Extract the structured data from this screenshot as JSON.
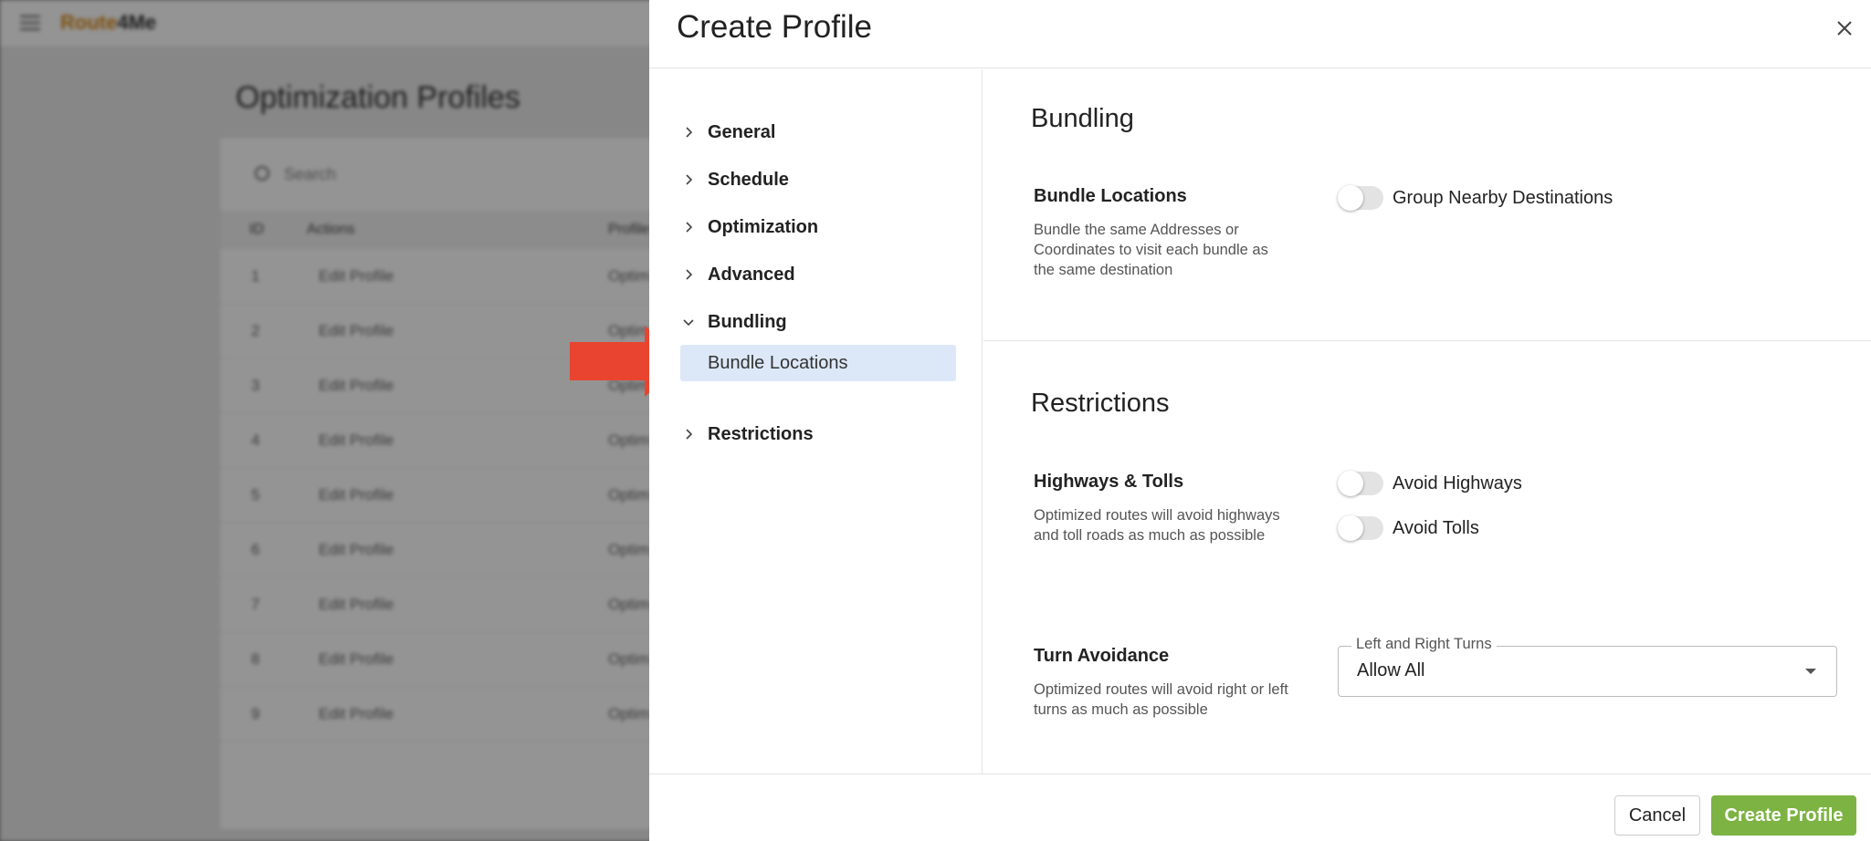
{
  "background": {
    "logo_prefix": "Route",
    "logo_suffix": "4Me",
    "page_title": "Optimization Profiles",
    "search_placeholder": "Search",
    "columns": [
      "ID",
      "Actions",
      "Profile"
    ],
    "rows": [
      {
        "id": "1",
        "action": "Edit Profile",
        "profile": "Optim"
      },
      {
        "id": "2",
        "action": "Edit Profile",
        "profile": "Optim"
      },
      {
        "id": "3",
        "action": "Edit Profile",
        "profile": "Optim"
      },
      {
        "id": "4",
        "action": "Edit Profile",
        "profile": "Optim"
      },
      {
        "id": "5",
        "action": "Edit Profile",
        "profile": "Optim"
      },
      {
        "id": "6",
        "action": "Edit Profile",
        "profile": "Optim"
      },
      {
        "id": "7",
        "action": "Edit Profile",
        "profile": "Optim"
      },
      {
        "id": "8",
        "action": "Edit Profile",
        "profile": "Optim"
      },
      {
        "id": "9",
        "action": "Edit Profile",
        "profile": "Optim"
      }
    ]
  },
  "drawer": {
    "title": "Create Profile",
    "close_icon": "close-icon"
  },
  "nav": {
    "items": [
      {
        "label": "General",
        "expanded": false
      },
      {
        "label": "Schedule",
        "expanded": false
      },
      {
        "label": "Optimization",
        "expanded": false
      },
      {
        "label": "Advanced",
        "expanded": false
      },
      {
        "label": "Bundling",
        "expanded": true
      },
      {
        "label": "Restrictions",
        "expanded": false
      }
    ],
    "active_sub": "Bundle Locations"
  },
  "bundling": {
    "title": "Bundling",
    "bundle_locations": {
      "title": "Bundle Locations",
      "desc": "Bundle the same Addresses or Coordinates to visit each bundle as the same destination",
      "toggle_label": "Group Nearby Destinations",
      "toggle_on": false
    }
  },
  "restrictions": {
    "title": "Restrictions",
    "highways_tolls": {
      "title": "Highways & Tolls",
      "desc": "Optimized routes will avoid highways and toll roads as much as possible",
      "avoid_highways_label": "Avoid Highways",
      "avoid_highways_on": false,
      "avoid_tolls_label": "Avoid Tolls",
      "avoid_tolls_on": false
    },
    "turn_avoidance": {
      "title": "Turn Avoidance",
      "desc": "Optimized routes will avoid right or left turns as much as possible",
      "select_label": "Left and Right Turns",
      "select_value": "Allow All"
    }
  },
  "footer": {
    "cancel_label": "Cancel",
    "create_label": "Create Profile"
  },
  "colors": {
    "accent_green": "#7cb342",
    "active_nav_bg": "#dce8f7",
    "arrow_red": "#e8442f"
  }
}
